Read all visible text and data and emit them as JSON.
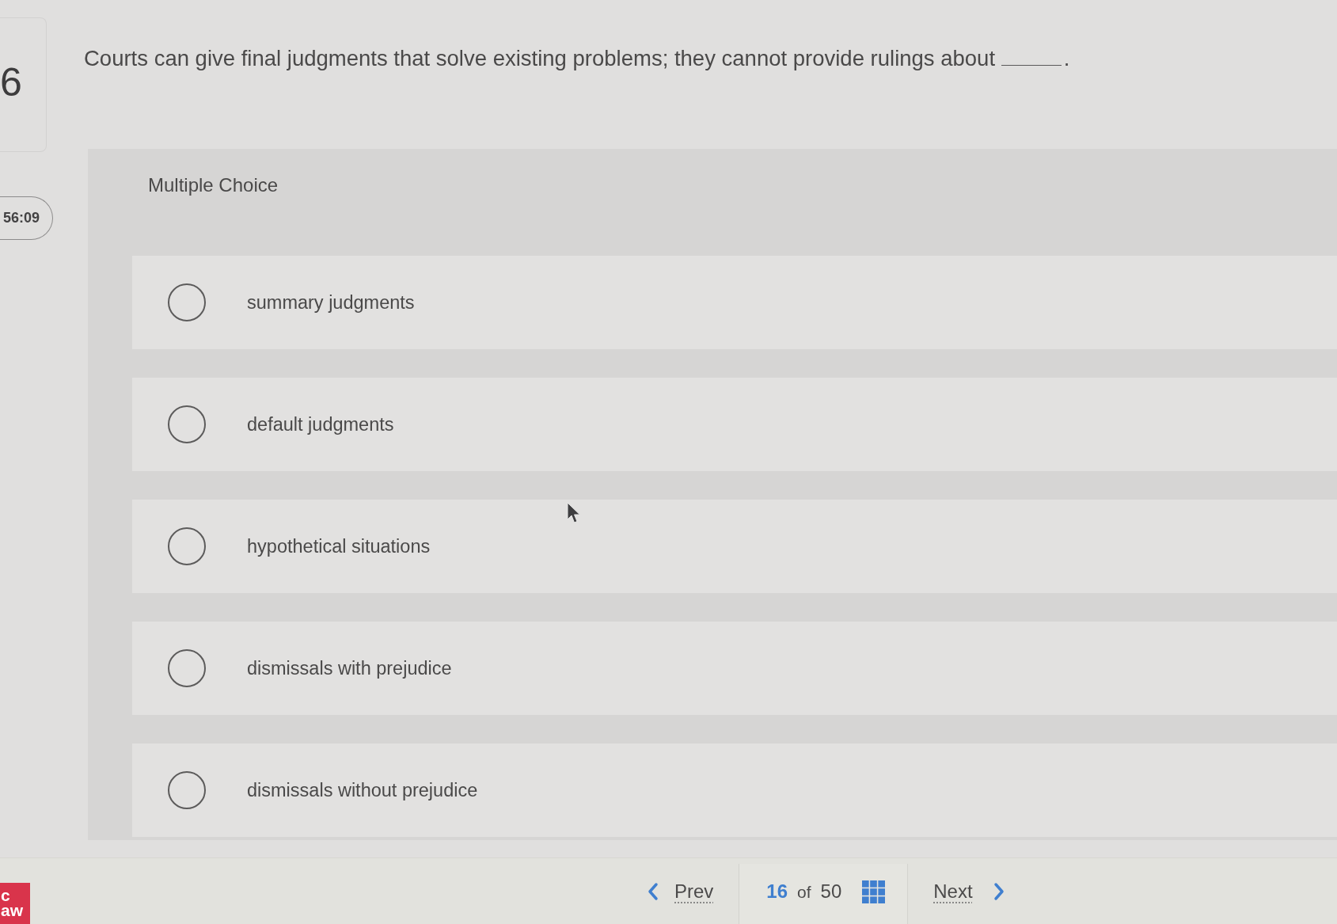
{
  "question_number": "6",
  "timer": "56:09",
  "question": {
    "prompt": "Courts can give final judgments that solve existing problems; they cannot provide rulings about",
    "after_blank": "."
  },
  "answer_panel": {
    "type_label": "Multiple Choice",
    "options": [
      {
        "label": "summary judgments",
        "selected": false
      },
      {
        "label": "default judgments",
        "selected": false
      },
      {
        "label": "hypothetical situations",
        "selected": false
      },
      {
        "label": "dismissals with prejudice",
        "selected": false
      },
      {
        "label": "dismissals without prejudice",
        "selected": false
      }
    ]
  },
  "footer": {
    "logo_lines": [
      "c",
      "aw"
    ],
    "prev": "Prev",
    "position": {
      "current": "16",
      "separator": "of",
      "total": "50"
    },
    "next": "Next"
  }
}
